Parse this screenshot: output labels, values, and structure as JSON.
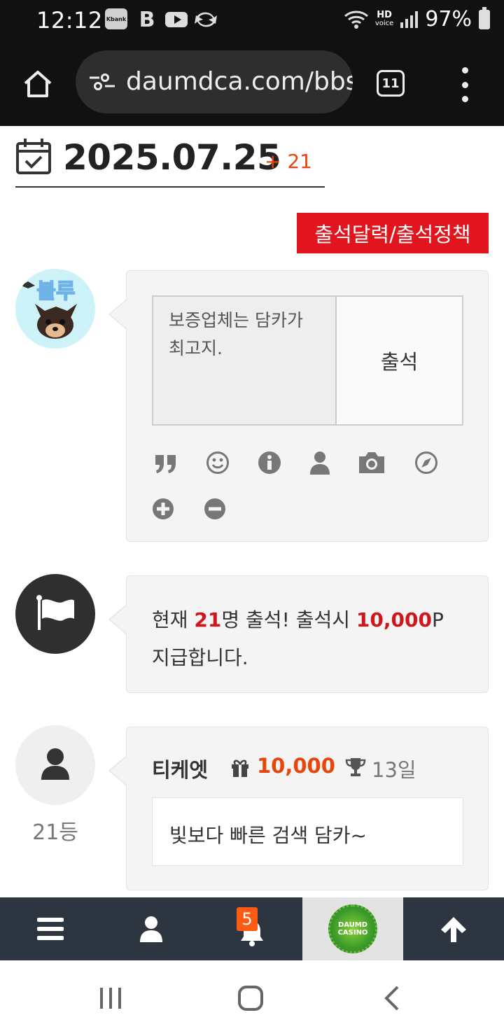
{
  "status_bar": {
    "time": "12:12",
    "kbank_label": "Kbank",
    "b_label": "B",
    "hd_label": "HD",
    "voice_label": "voice",
    "battery": "97%"
  },
  "browser": {
    "url": "daumdca.com/bbs",
    "tab_count": "11",
    "icons": [
      "home-icon",
      "site-settings-icon",
      "tabs-icon",
      "more-menu-icon"
    ]
  },
  "header": {
    "date": "2025.07.25",
    "count_label": "+ 21"
  },
  "policy_button": "출석달력/출석정책",
  "attendance_form": {
    "memo_text": "보증업체는 담카가 최고지.",
    "submit_label": "출석",
    "tools": [
      "quote-icon",
      "smile-icon",
      "info-icon",
      "user-icon",
      "camera-icon",
      "compass-icon",
      "plus-icon",
      "minus-icon"
    ]
  },
  "notice": {
    "prefix": "현재 ",
    "count": "21",
    "middle": "명 출석! 출석시 ",
    "points": "10,000",
    "suffix": "P",
    "line2": "지급합니다."
  },
  "entry": {
    "rank": "21등",
    "nickname": "티케엣",
    "points": "10,000",
    "days": "13일",
    "comment": "빛보다 빠른 검색 담카~"
  },
  "bottom_nav": {
    "notification_count": "5",
    "casino_logo_text": "DAUMD CASINO"
  },
  "colors": {
    "accent_red": "#e0151e",
    "points_orange": "#e8450b",
    "nav_bg": "#2d3540"
  }
}
